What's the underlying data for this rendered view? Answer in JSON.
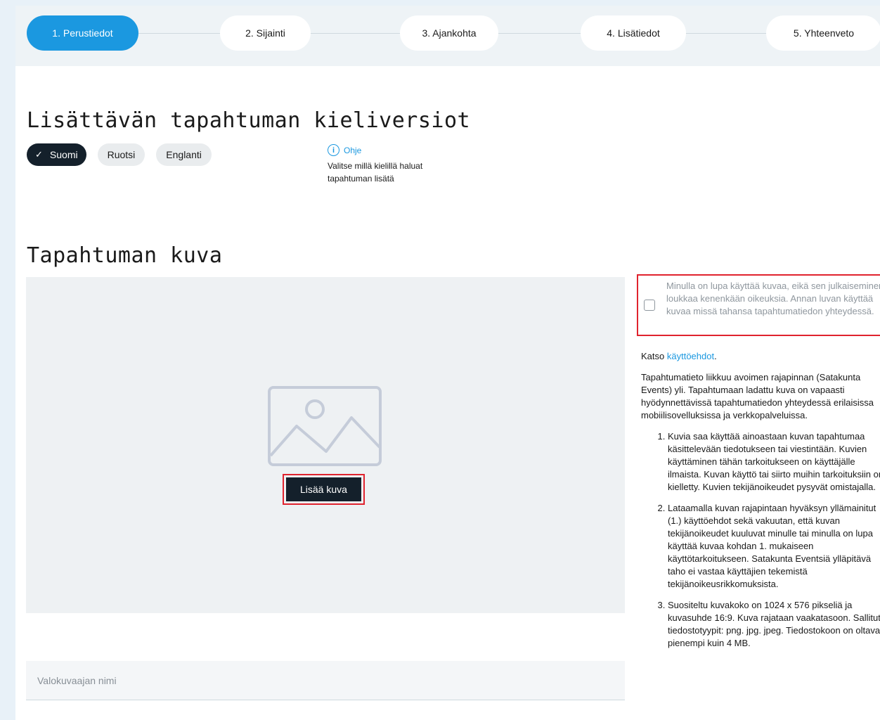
{
  "stepper": {
    "steps": [
      {
        "label": "1. Perustiedot"
      },
      {
        "label": "2. Sijainti"
      },
      {
        "label": "3. Ajankohta"
      },
      {
        "label": "4. Lisätiedot"
      },
      {
        "label": "5. Yhteenveto"
      }
    ],
    "active_step": 1,
    "colors": {
      "active": "#1b98e0",
      "inactive": "#ffffff"
    }
  },
  "languages": {
    "title": "Lisättävän tapahtuman kieliversiot",
    "chips": [
      {
        "label": "Suomi",
        "selected": true
      },
      {
        "label": "Ruotsi",
        "selected": false
      },
      {
        "label": "Englanti",
        "selected": false
      }
    ],
    "help": {
      "icon": "info-icon",
      "link": "Ohje",
      "text": "Valitse millä kielillä haluat tapahtuman lisätä"
    }
  },
  "image": {
    "title": "Tapahtuman kuva",
    "placeholder_icon": "image-placeholder-icon",
    "add_button": "Lisää kuva",
    "photographer_placeholder": "Valokuvaajan nimi"
  },
  "consent": {
    "checked": false,
    "text": "Minulla on lupa käyttää kuvaa, eikä sen julkaiseminen loukkaa kenenkään oikeuksia. Annan luvan käyttää kuvaa missä tahansa tapahtumatiedon yhteydessä."
  },
  "terms": {
    "see_prefix": "Katso ",
    "see_link": "käyttöehdot",
    "see_suffix": ".",
    "intro": "Tapahtumatieto liikkuu avoimen rajapinnan (Satakunta Events) yli. Tapahtumaan ladattu kuva on vapaasti hyödynnettävissä tapahtumatiedon yhteydessä erilaisissa mobiilisovelluksissa ja verkkopalveluissa.",
    "items": [
      "Kuvia saa käyttää ainoastaan kuvan tapahtumaa käsittelevään tiedotukseen tai viestintään. Kuvien käyttäminen tähän tarkoitukseen on käyttäjälle ilmaista. Kuvan käyttö tai siirto muihin tarkoituksiin on kielletty. Kuvien tekijänoikeudet pysyvät omistajalla.",
      "Lataamalla kuvan rajapintaan hyväksyn yllämainitut (1.) käyttöehdot sekä vakuutan, että kuvan tekijänoikeudet kuuluvat minulle tai minulla on lupa käyttää kuvaa kohdan 1. mukaiseen käyttötarkoitukseen. Satakunta Eventsiä ylläpitävä taho ei vastaa käyttäjien tekemistä tekijänoikeusrikkomuksista.",
      "Suositeltu kuvakoko on 1024 x 576 pikseliä ja kuvasuhde 16:9. Kuva rajataan vaakatasoon. Sallitut tiedostotyypit: png. jpg. jpeg. Tiedostokoon on oltava pienempi kuin 4 MB."
    ]
  }
}
